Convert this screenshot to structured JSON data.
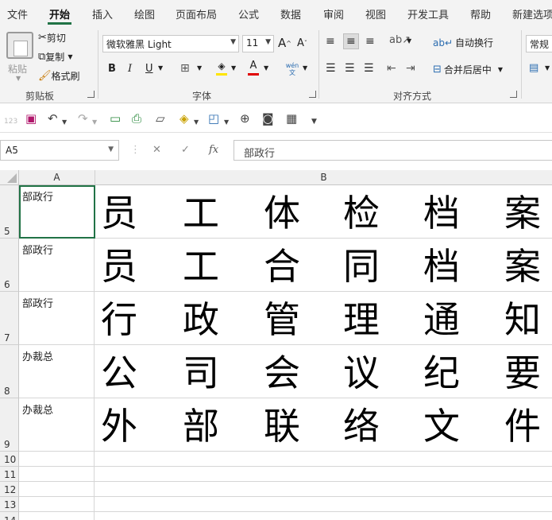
{
  "menu": {
    "tabs": [
      "文件",
      "开始",
      "插入",
      "绘图",
      "页面布局",
      "公式",
      "数据",
      "审阅",
      "视图",
      "开发工具",
      "帮助",
      "新建选项卡"
    ],
    "active": "开始"
  },
  "ribbon": {
    "clipboard": {
      "paste": "粘贴",
      "cut": "剪切",
      "copy": "复制",
      "format_painter": "格式刷",
      "group_label": "剪贴板"
    },
    "font": {
      "font_name": "微软雅黑 Light",
      "font_size": "11",
      "grow": "A",
      "shrink": "A",
      "bold": "B",
      "italic": "I",
      "underline": "U",
      "phonetic": "wén 文",
      "group_label": "字体"
    },
    "alignment": {
      "wrap_text": "自动换行",
      "merge_center": "合并后居中",
      "group_label": "对齐方式"
    },
    "number": {
      "format": "常规"
    }
  },
  "formula_bar": {
    "name_box": "A5",
    "fx": "fx",
    "content": "部政行"
  },
  "grid": {
    "columns": [
      "A",
      "B"
    ],
    "rows": [
      {
        "num": "5",
        "a": "部政行",
        "chars": [
          "员",
          "工",
          "体",
          "检",
          "档",
          "案"
        ]
      },
      {
        "num": "6",
        "a": "部政行",
        "chars": [
          "员",
          "工",
          "合",
          "同",
          "档",
          "案"
        ]
      },
      {
        "num": "7",
        "a": "部政行",
        "chars": [
          "行",
          "政",
          "管",
          "理",
          "通",
          "知"
        ]
      },
      {
        "num": "8",
        "a": "办裁总",
        "chars": [
          "公",
          "司",
          "会",
          "议",
          "纪",
          "要"
        ]
      },
      {
        "num": "9",
        "a": "办裁总",
        "chars": [
          "外",
          "部",
          "联",
          "络",
          "文",
          "件"
        ]
      }
    ],
    "empty_rows": [
      "10",
      "11",
      "12",
      "13",
      "14"
    ]
  },
  "colors": {
    "accent": "#217346",
    "ribbon_bg": "#f3f3f3",
    "highlight_yellow": "#ffe500",
    "font_red": "#e00000"
  }
}
